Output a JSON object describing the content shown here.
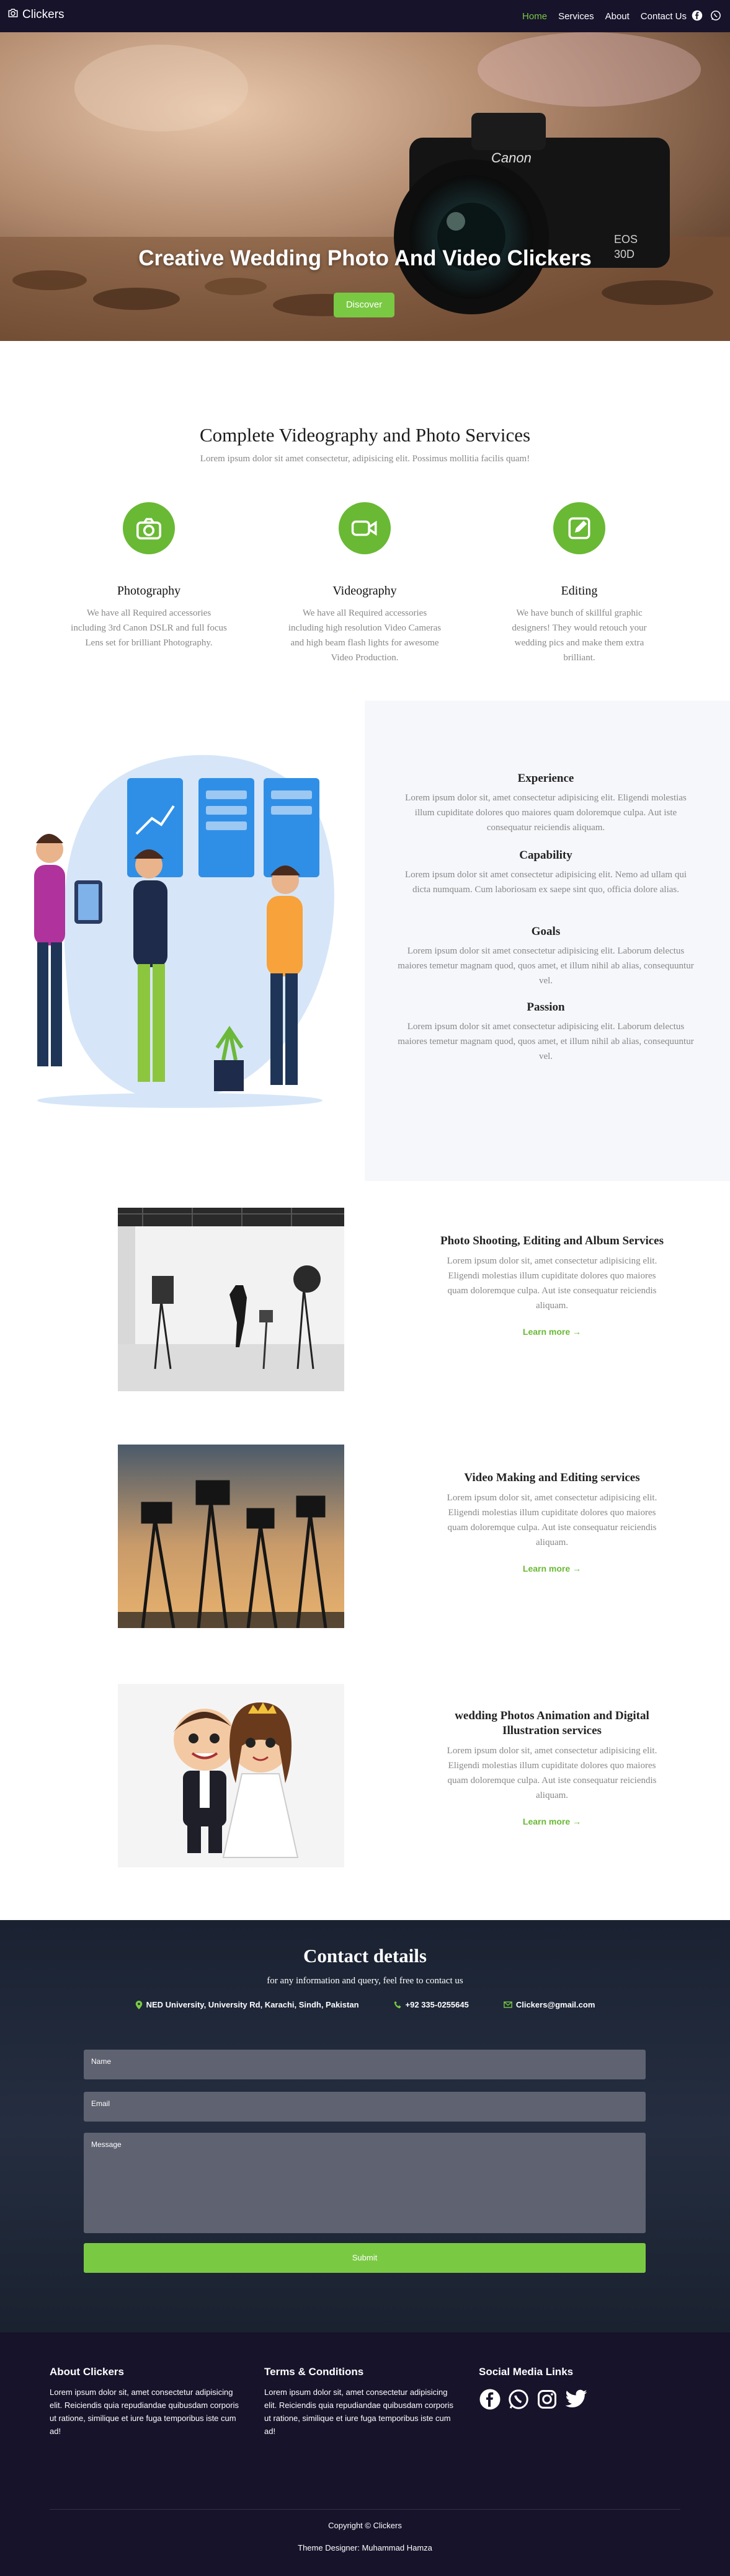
{
  "nav": {
    "brand": "Clickers",
    "links": [
      "Home",
      "Services",
      "About",
      "Contact Us"
    ]
  },
  "hero": {
    "title": "Creative Wedding Photo And Video Clickers",
    "button": "Discover"
  },
  "services": {
    "title": "Complete Videography and Photo Services",
    "subtitle": "Lorem ipsum dolor sit amet consectetur, adipisicing elit. Possimus mollitia facilis quam!",
    "items": [
      {
        "title": "Photography",
        "text": "We have all Required accessories including 3rd Canon DSLR and full focus Lens set for brilliant Photography."
      },
      {
        "title": "Videography",
        "text": "We have all Required accessories including high resolution Video Cameras and high beam flash lights for awesome Video Production."
      },
      {
        "title": "Editing",
        "text": "We have bunch of skillful graphic designers! They would retouch your wedding pics and make them extra brilliant."
      }
    ]
  },
  "about": {
    "items": [
      {
        "title": "Experience",
        "text": "Lorem ipsum dolor sit, amet consectetur adipisicing elit. Eligendi molestias illum cupiditate dolores quo maiores quam doloremque culpa. Aut iste consequatur reiciendis aliquam."
      },
      {
        "title": "Capability",
        "text": "Lorem ipsum dolor sit amet consectetur adipisicing elit. Nemo ad ullam qui dicta numquam. Cum laboriosam ex saepe sint quo, officia dolore alias."
      },
      {
        "title": "Goals",
        "text": "Lorem ipsum dolor sit amet consectetur adipisicing elit. Laborum delectus maiores temetur magnam quod, quos amet, et illum nihil ab alias, consequuntur vel."
      },
      {
        "title": "Passion",
        "text": "Lorem ipsum dolor sit amet consectetur adipisicing elit. Laborum delectus maiores temetur magnam quod, quos amet, et illum nihil ab alias, consequuntur vel."
      }
    ]
  },
  "features": [
    {
      "title": "Photo Shooting, Editing and Album Services",
      "text": "Lorem ipsum dolor sit, amet consectetur adipisicing elit. Eligendi molestias illum cupiditate dolores quo maiores quam doloremque culpa. Aut iste consequatur reiciendis aliquam.",
      "link": "Learn more →"
    },
    {
      "title": "Video Making and Editing services",
      "text": "Lorem ipsum dolor sit, amet consectetur adipisicing elit. Eligendi molestias illum cupiditate dolores quo maiores quam doloremque culpa. Aut iste consequatur reiciendis aliquam.",
      "link": "Learn more →"
    },
    {
      "title": "wedding Photos Animation and Digital Illustration services",
      "text": "Lorem ipsum dolor sit, amet consectetur adipisicing elit. Eligendi molestias illum cupiditate dolores quo maiores quam doloremque culpa. Aut iste consequatur reiciendis aliquam.",
      "link": "Learn more →"
    }
  ],
  "contact": {
    "title": "Contact details",
    "subtitle": "for any information and query, feel free to contact us",
    "address": "NED University, University Rd, Karachi, Sindh, Pakistan",
    "phone": "+92 335-0255645",
    "email": "Clickers@gmail.com",
    "name_placeholder": "Name",
    "email_placeholder": "Email",
    "message_placeholder": "Message",
    "submit": "Submit"
  },
  "footer": {
    "about_title": "About Clickers",
    "about_text": "Lorem ipsum dolor sit, amet consectetur adipisicing elit. Reiciendis quia repudiandae quibusdam corporis ut ratione, similique et iure fuga temporibus iste cum ad!",
    "terms_title": "Terms & Conditions",
    "terms_text": "Lorem ipsum dolor sit, amet consectetur adipisicing elit. Reiciendis quia repudiandae quibusdam corporis ut ratione, similique et iure fuga temporibus iste cum ad!",
    "social_title": "Social Media Links",
    "copyright": "Copyright © Clickers",
    "designer": "Theme Designer: Muhammad Hamza"
  },
  "colors": {
    "accent": "#7ac943",
    "nav_bg": "#17132b"
  },
  "icons": [
    "camera-icon",
    "video-icon",
    "edit-icon",
    "facebook-icon",
    "whatsapp-icon",
    "instagram-icon",
    "twitter-icon",
    "location-icon",
    "phone-icon",
    "mail-icon",
    "arrow-right-icon"
  ]
}
